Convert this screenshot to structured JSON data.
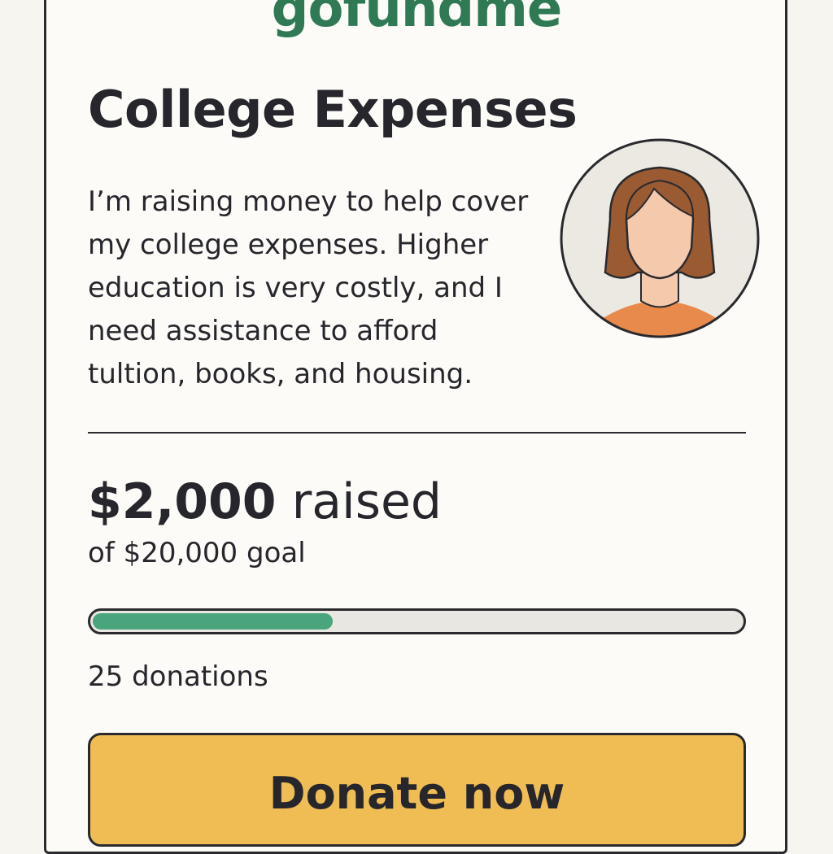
{
  "brand": {
    "name": "gofundme"
  },
  "campaign": {
    "title": "College Expenses",
    "description": "I’m raising money to help cover my college expenses. Higher education is very costly, and I need assistance to afford tultion, books, and housing.",
    "avatar_icon": "person-avatar-icon"
  },
  "stats": {
    "raised_amount": "$2,000",
    "raised_suffix": " raised",
    "goal_text": "of $20,000 goal",
    "progress_fraction": 0.37,
    "donations_text": "25 donations"
  },
  "actions": {
    "donate_label": "Donate now"
  },
  "colors": {
    "brand": "#2f7a55",
    "progress": "#4aa57c",
    "button": "#f0bd54",
    "hair": "#9a5a32",
    "skin": "#f5c9ac",
    "shirt": "#e88a4c"
  }
}
